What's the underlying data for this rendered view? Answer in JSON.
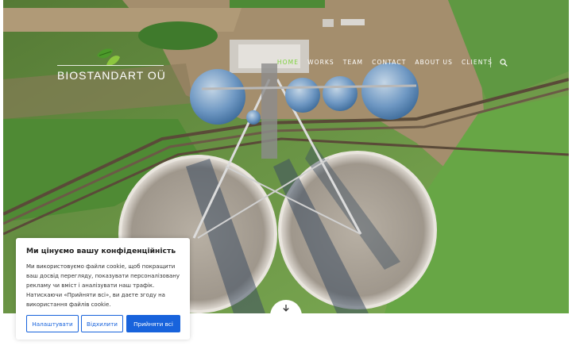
{
  "brand": {
    "name": "BIOSTANDART OÜ"
  },
  "nav": {
    "items": [
      {
        "label": "HOME",
        "active": true
      },
      {
        "label": "WORKS",
        "active": false
      },
      {
        "label": "TEAM",
        "active": false
      },
      {
        "label": "CONTACT",
        "active": false
      },
      {
        "label": "ABOUT US",
        "active": false
      },
      {
        "label": "CLIENTS",
        "active": false
      }
    ],
    "search_icon": "search-icon"
  },
  "hero": {
    "scroll_icon": "arrow-down-icon"
  },
  "cookie": {
    "title": "Ми цінуємо вашу конфіденційність",
    "lines": [
      "Ми використовуємо файли cookie, щоб покращити",
      "ваш досвід перегляду, показувати персоналізовану",
      "рекламу чи вміст і аналізувати наш трафік.",
      "Натискаючи «Прийняти всі», ви даєте згоду на",
      "використання файлів cookie."
    ],
    "buttons": {
      "customize": "Налаштувати",
      "reject": "Відхилити",
      "accept": "Прийняти всі"
    }
  },
  "colors": {
    "accent": "#7fd23f",
    "button": "#1863dc"
  }
}
